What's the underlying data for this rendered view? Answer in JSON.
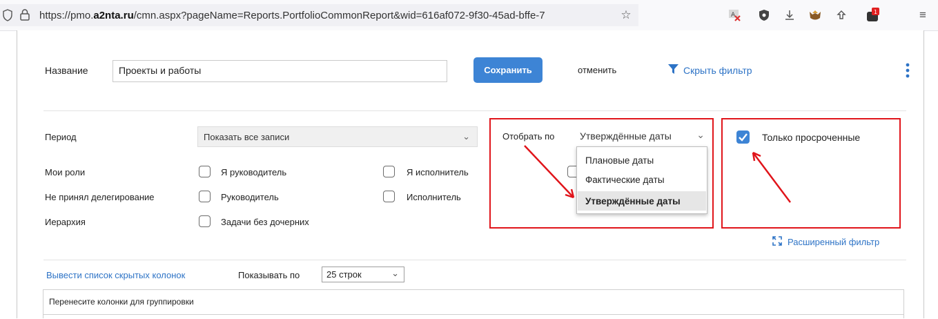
{
  "browser": {
    "url_prefix": "https://pmo.",
    "url_domain": "a2nta.ru",
    "url_rest": "/cmn.aspx?pageName=Reports.PortfolioCommonReport&wid=616af072-9f30-45ad-bffe-7"
  },
  "header": {
    "name_label": "Название",
    "name_value": "Проекты и работы",
    "save_label": "Сохранить",
    "cancel_label": "отменить",
    "hide_filter_label": "Скрыть фильтр"
  },
  "filters": {
    "period_label": "Период",
    "period_value": "Показать все записи",
    "roles_label": "Мои роли",
    "role_manager": "Я руководитель",
    "role_executor": "Я исполнитель",
    "delegation_label": "Не принял делегирование",
    "deleg_manager": "Руководитель",
    "deleg_executor": "Исполнитель",
    "hierarchy_label": "Иерархия",
    "hierarchy_option": "Задачи без дочерних",
    "display_by_label": "Отобрать по",
    "display_by_value": "Утверждённые даты",
    "display_options": [
      "Плановые даты",
      "Фактические даты",
      "Утверждённые даты"
    ],
    "overdue_label": "Только просроченные",
    "overdue_checked": true,
    "advanced_filter_label": "Расширенный фильтр"
  },
  "table": {
    "hidden_columns_link": "Вывести список скрытых колонок",
    "page_size_label": "Показывать по",
    "page_size_value": "25 строк",
    "grouping_hint": "Перенесите колонки для группировки"
  },
  "colors": {
    "accent": "#3d84d5",
    "link": "#2d73c6",
    "annotation_red": "#e0141a"
  }
}
